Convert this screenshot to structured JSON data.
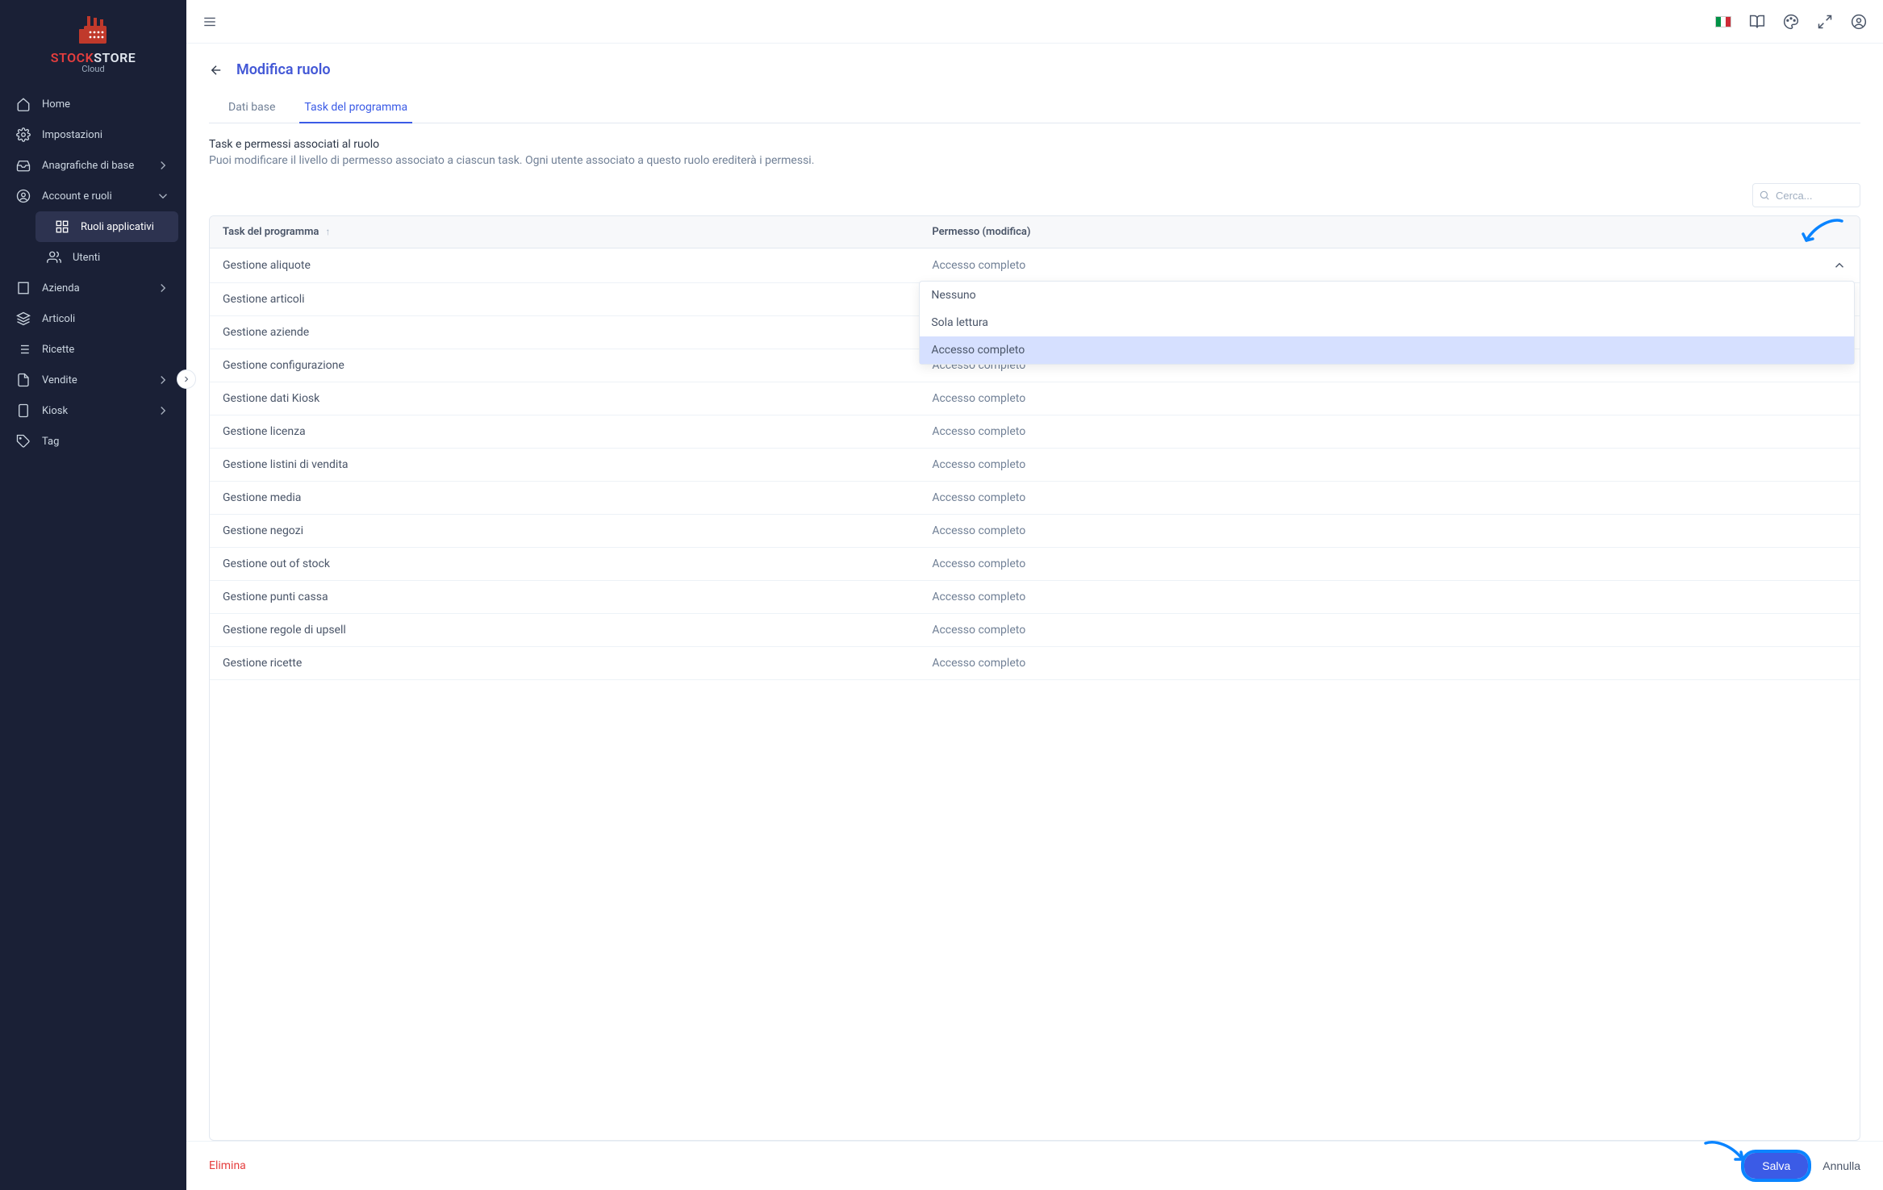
{
  "brand": {
    "name1": "STOCK",
    "name2": "STORE",
    "sub": "Cloud"
  },
  "sidebar": {
    "items": [
      {
        "label": "Home",
        "icon": "home"
      },
      {
        "label": "Impostazioni",
        "icon": "gear"
      },
      {
        "label": "Anagrafiche di base",
        "icon": "inbox",
        "expandable": true
      },
      {
        "label": "Account e ruoli",
        "icon": "user-circle",
        "expandable": true,
        "expanded": true
      },
      {
        "label": "Azienda",
        "icon": "building",
        "expandable": true
      },
      {
        "label": "Articoli",
        "icon": "layers"
      },
      {
        "label": "Ricette",
        "icon": "list"
      },
      {
        "label": "Vendite",
        "icon": "doc",
        "expandable": true
      },
      {
        "label": "Kiosk",
        "icon": "tablet",
        "expandable": true
      },
      {
        "label": "Tag",
        "icon": "tag"
      }
    ],
    "sub_account": [
      {
        "label": "Ruoli applicativi",
        "icon": "grid",
        "active": true
      },
      {
        "label": "Utenti",
        "icon": "users"
      }
    ]
  },
  "page": {
    "title": "Modifica ruolo",
    "tabs": [
      {
        "label": "Dati base",
        "active": false
      },
      {
        "label": "Task del programma",
        "active": true
      }
    ],
    "intro_title": "Task e permessi associati al ruolo",
    "intro_desc": "Puoi modificare il livello di permesso associato a ciascun task. Ogni utente associato a questo ruolo erediterà i permessi."
  },
  "search": {
    "placeholder": "Cerca..."
  },
  "table": {
    "col_task": "Task del programma",
    "col_perm": "Permesso (modifica)",
    "rows": [
      {
        "task": "Gestione aliquote",
        "perm": "Accesso completo",
        "open": true
      },
      {
        "task": "Gestione articoli",
        "perm": ""
      },
      {
        "task": "Gestione aziende",
        "perm": ""
      },
      {
        "task": "Gestione configurazione",
        "perm": "Accesso completo"
      },
      {
        "task": "Gestione dati Kiosk",
        "perm": "Accesso completo"
      },
      {
        "task": "Gestione licenza",
        "perm": "Accesso completo"
      },
      {
        "task": "Gestione listini di vendita",
        "perm": "Accesso completo"
      },
      {
        "task": "Gestione media",
        "perm": "Accesso completo"
      },
      {
        "task": "Gestione negozi",
        "perm": "Accesso completo"
      },
      {
        "task": "Gestione out of stock",
        "perm": "Accesso completo"
      },
      {
        "task": "Gestione punti cassa",
        "perm": "Accesso completo"
      },
      {
        "task": "Gestione regole di upsell",
        "perm": "Accesso completo"
      },
      {
        "task": "Gestione ricette",
        "perm": "Accesso completo"
      }
    ],
    "dropdown_options": [
      {
        "label": "Nessuno",
        "selected": false
      },
      {
        "label": "Sola lettura",
        "selected": false
      },
      {
        "label": "Accesso completo",
        "selected": true
      }
    ]
  },
  "footer": {
    "delete": "Elimina",
    "save": "Salva",
    "cancel": "Annulla"
  }
}
